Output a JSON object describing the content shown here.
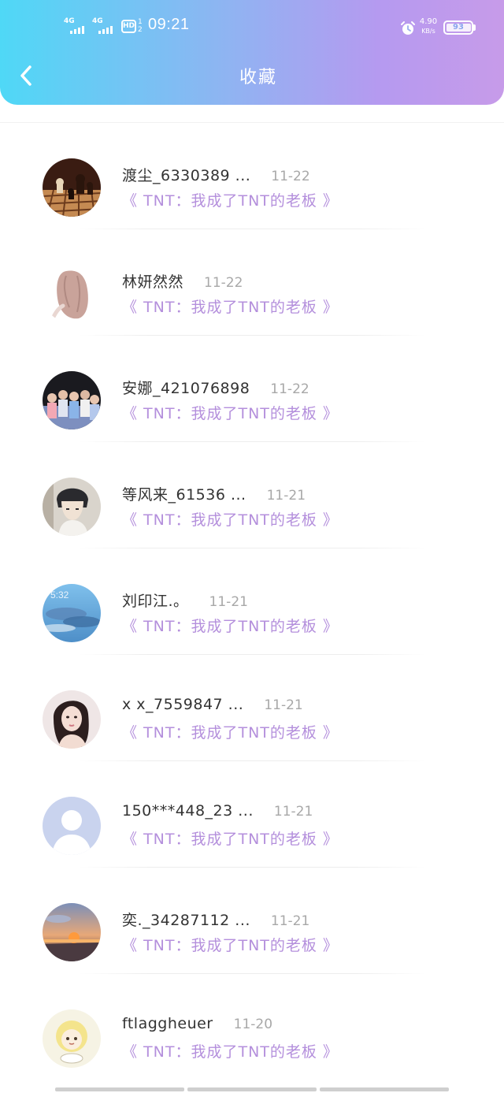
{
  "status_bar": {
    "sim1_network": "4G",
    "sim2_network": "4G",
    "hd_label": "HD",
    "hd_sub_top": "1",
    "hd_sub_bottom": "2",
    "time": "09:21",
    "speed_value": "4.90",
    "speed_unit": "KB/s",
    "battery_level": "93",
    "icons": [
      "signal-icon",
      "hd-voice-icon",
      "alarm-icon",
      "battery-icon"
    ]
  },
  "header": {
    "title": "收藏",
    "back_icon": "chevron-left-icon",
    "gradient_colors": [
      "#4fd8f6",
      "#8fb4f2",
      "#c79be9"
    ]
  },
  "accent_color": "#b48fdc",
  "list": [
    {
      "username": "渡尘_6330389 ...",
      "date": "11-22",
      "title": "《 TNT：我成了TNT的老板 》",
      "avatar": "chess-avatar"
    },
    {
      "username": "林妍然然",
      "date": "11-22",
      "title": "《 TNT：我成了TNT的老板 》",
      "avatar": "girl-pink-hair-avatar"
    },
    {
      "username": "安娜_421076898",
      "date": "11-22",
      "title": "《 TNT：我成了TNT的老板 》",
      "avatar": "group-photo-avatar"
    },
    {
      "username": "等风来_61536 ...",
      "date": "11-21",
      "title": "《 TNT：我成了TNT的老板 》",
      "avatar": "anime-boy-avatar"
    },
    {
      "username": "刘印江.。",
      "date": "11-21",
      "title": "《 TNT：我成了TNT的老板 》",
      "avatar": "sky-clouds-avatar"
    },
    {
      "username": "x x_7559847 ...",
      "date": "11-21",
      "title": "《 TNT：我成了TNT的老板 》",
      "avatar": "girl-portrait-avatar"
    },
    {
      "username": "150***448_23 ...",
      "date": "11-21",
      "title": "《 TNT：我成了TNT的老板 》",
      "avatar": "default-avatar"
    },
    {
      "username": "奕._34287112 ...",
      "date": "11-21",
      "title": "《 TNT：我成了TNT的老板 》",
      "avatar": "sunset-avatar"
    },
    {
      "username": "ftlaggheuer",
      "date": "11-20",
      "title": "《 TNT：我成了TNT的老板 》",
      "avatar": "cartoon-avatar"
    }
  ]
}
